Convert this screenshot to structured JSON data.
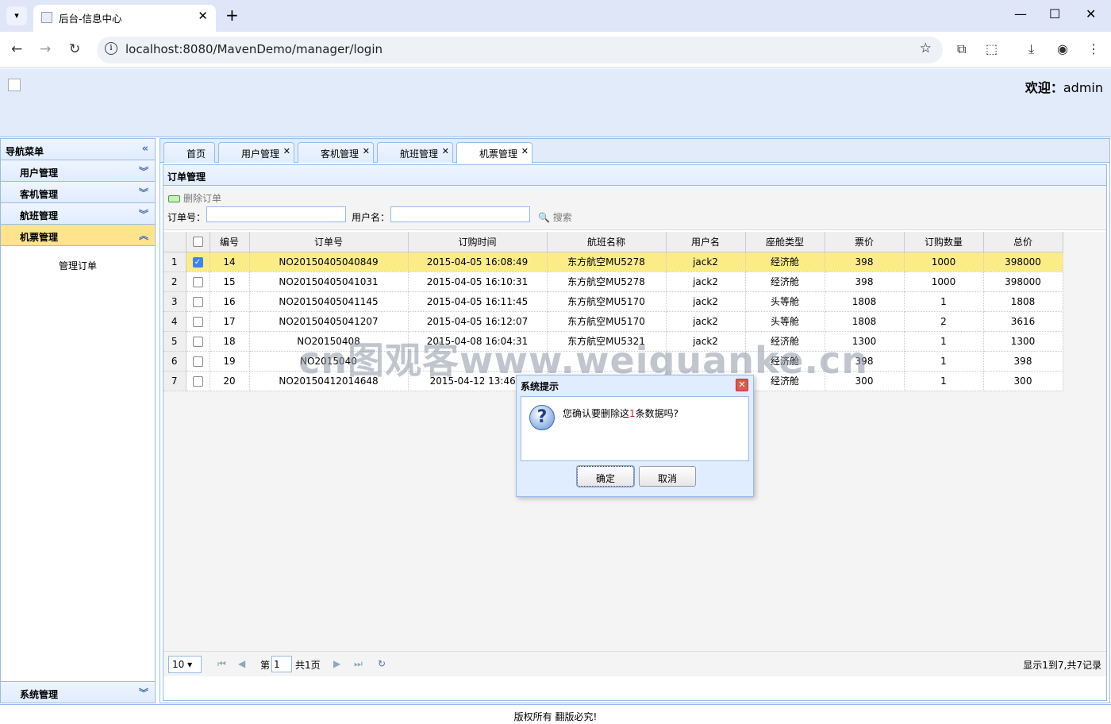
{
  "browser": {
    "tab_title": "后台-信息中心",
    "url": "localhost:8080/MavenDemo/manager/login"
  },
  "banner": {
    "welcome_prefix": "欢迎：",
    "username": "admin"
  },
  "nav": {
    "title": "导航菜单",
    "sections": [
      "用户管理",
      "客机管理",
      "航班管理",
      "机票管理"
    ],
    "active_item": "管理订单",
    "bottom_section": "系统管理"
  },
  "tabs": [
    {
      "label": "首页",
      "closable": false
    },
    {
      "label": "用户管理",
      "closable": true
    },
    {
      "label": "客机管理",
      "closable": true
    },
    {
      "label": "航班管理",
      "closable": true
    },
    {
      "label": "机票管理",
      "closable": true
    }
  ],
  "panel": {
    "title": "订单管理",
    "delete_button": "删除订单",
    "order_no_label": "订单号：",
    "username_label": "用户名：",
    "order_no_value": "",
    "username_value": "",
    "search_button": "搜索"
  },
  "grid": {
    "headers": [
      "编号",
      "订单号",
      "订购时间",
      "航班名称",
      "用户名",
      "座舱类型",
      "票价",
      "订购数量",
      "总价"
    ],
    "rows": [
      {
        "rn": "1",
        "checked": true,
        "id": "14",
        "order_no": "NO20150405040849",
        "time": "2015-04-05 16:08:49",
        "flight": "东方航空MU5278",
        "user": "jack2",
        "cabin": "经济舱",
        "price": "398",
        "qty": "1000",
        "total": "398000"
      },
      {
        "rn": "2",
        "checked": false,
        "id": "15",
        "order_no": "NO20150405041031",
        "time": "2015-04-05 16:10:31",
        "flight": "东方航空MU5278",
        "user": "jack2",
        "cabin": "经济舱",
        "price": "398",
        "qty": "1000",
        "total": "398000"
      },
      {
        "rn": "3",
        "checked": false,
        "id": "16",
        "order_no": "NO20150405041145",
        "time": "2015-04-05 16:11:45",
        "flight": "东方航空MU5170",
        "user": "jack2",
        "cabin": "头等舱",
        "price": "1808",
        "qty": "1",
        "total": "1808"
      },
      {
        "rn": "4",
        "checked": false,
        "id": "17",
        "order_no": "NO20150405041207",
        "time": "2015-04-05 16:12:07",
        "flight": "东方航空MU5170",
        "user": "jack2",
        "cabin": "头等舱",
        "price": "1808",
        "qty": "2",
        "total": "3616"
      },
      {
        "rn": "5",
        "checked": false,
        "id": "18",
        "order_no": "NO20150408",
        "time": "2015-04-08 16:04:31",
        "flight": "东方航空MU5321",
        "user": "jack2",
        "cabin": "经济舱",
        "price": "1300",
        "qty": "1",
        "total": "1300"
      },
      {
        "rn": "6",
        "checked": false,
        "id": "19",
        "order_no": "NO2015040",
        "time": "",
        "flight": "",
        "user": "",
        "cabin": "经济舱",
        "price": "398",
        "qty": "1",
        "total": "398"
      },
      {
        "rn": "7",
        "checked": false,
        "id": "20",
        "order_no": "NO20150412014648",
        "time": "2015-04-12 13:46:4",
        "flight": "",
        "user": "",
        "cabin": "经济舱",
        "price": "300",
        "qty": "1",
        "total": "300"
      }
    ]
  },
  "pager": {
    "page_size": "10",
    "page_prefix": "第",
    "page_value": "1",
    "page_suffix": "共1页",
    "info": "显示1到7,共7记录"
  },
  "footer": "版权所有 翻版必究!",
  "watermark": "cn图观客www.weiguanke.cn",
  "dialog": {
    "title": "系统提示",
    "msg_prefix": "您确认要删除这",
    "msg_count": "1",
    "msg_suffix": "条数据吗?",
    "ok": "确定",
    "cancel": "取消"
  },
  "colors": {
    "selected_row": "#fbec88",
    "accordion_active": "#ffe48d",
    "border": "#99bbe8"
  }
}
